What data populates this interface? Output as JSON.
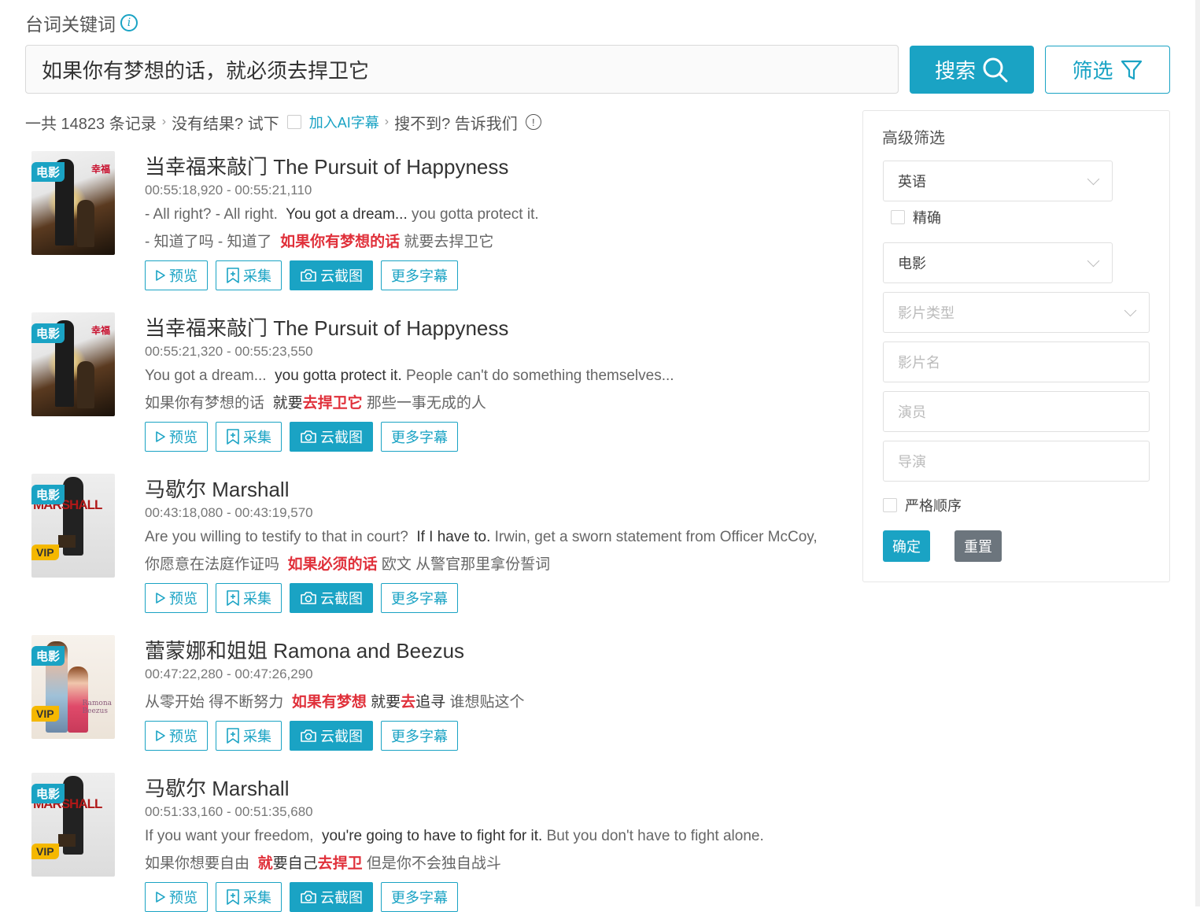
{
  "header": {
    "keyword_label": "台词关键词",
    "search_value": "如果你有梦想的话，就必须去捍卫它",
    "search_button": "搜索",
    "filter_button": "筛选"
  },
  "summary": {
    "total": "一共 14823 条记录",
    "no_result": "没有结果? 试下",
    "ai_link": "加入AI字幕",
    "not_found": "搜不到? 告诉我们"
  },
  "actions": {
    "preview": "预览",
    "collect": "采集",
    "screenshot": "云截图",
    "more": "更多字幕"
  },
  "badges": {
    "movie": "电影",
    "vip": "VIP"
  },
  "results": [
    {
      "title": "当幸福来敲门 The Pursuit of Happyness",
      "time": "00:55:18,920 - 00:55:21,110",
      "en": [
        {
          "t": "- All right? - All right.  ",
          "s": ""
        },
        {
          "t": "You got a dream...",
          "s": "dark"
        },
        {
          "t": " you gotta protect it.",
          "s": ""
        }
      ],
      "zh": [
        {
          "t": "- 知道了吗 - 知道了  ",
          "s": ""
        },
        {
          "t": "如果你有梦想的话",
          "s": "hl"
        },
        {
          "t": " 就要去捍卫它",
          "s": ""
        }
      ],
      "vip": false,
      "poster": "pursuit"
    },
    {
      "title": "当幸福来敲门 The Pursuit of Happyness",
      "time": "00:55:21,320 - 00:55:23,550",
      "en": [
        {
          "t": "You got a dream...  ",
          "s": ""
        },
        {
          "t": "you gotta protect it.",
          "s": "dark"
        },
        {
          "t": " People can't do something themselves...",
          "s": ""
        }
      ],
      "zh": [
        {
          "t": "如果你有梦想的话  ",
          "s": ""
        },
        {
          "t": "就要",
          "s": "dark"
        },
        {
          "t": "去捍卫它",
          "s": "hl"
        },
        {
          "t": " 那些一事无成的人",
          "s": ""
        }
      ],
      "vip": false,
      "poster": "pursuit"
    },
    {
      "title": "马歇尔 Marshall",
      "time": "00:43:18,080 - 00:43:19,570",
      "en": [
        {
          "t": "Are you willing to testify to that in court?  ",
          "s": ""
        },
        {
          "t": "If I have to.",
          "s": "dark"
        },
        {
          "t": " Irwin, get a sworn statement from Officer McCoy,",
          "s": ""
        }
      ],
      "zh": [
        {
          "t": "你愿意在法庭作证吗  ",
          "s": ""
        },
        {
          "t": "如果必须的话",
          "s": "hl"
        },
        {
          "t": " 欧文 从警官那里拿份誓词",
          "s": ""
        }
      ],
      "vip": true,
      "poster": "marshall"
    },
    {
      "title": "蕾蒙娜和姐姐 Ramona and Beezus",
      "time": "00:47:22,280 - 00:47:26,290",
      "zh": [
        {
          "t": "从零开始 得不断努力  ",
          "s": ""
        },
        {
          "t": "如果有梦想",
          "s": "hl"
        },
        {
          "t": " ",
          "s": ""
        },
        {
          "t": "就要",
          "s": "dark"
        },
        {
          "t": "去",
          "s": "hl"
        },
        {
          "t": "追寻",
          "s": "dark"
        },
        {
          "t": " 谁想贴这个",
          "s": ""
        }
      ],
      "vip": true,
      "poster": "ramona"
    },
    {
      "title": "马歇尔 Marshall",
      "time": "00:51:33,160 - 00:51:35,680",
      "en": [
        {
          "t": "If you want your freedom,  ",
          "s": ""
        },
        {
          "t": "you're going to have to fight for it.",
          "s": "dark"
        },
        {
          "t": " But you don't have to fight alone.",
          "s": ""
        }
      ],
      "zh": [
        {
          "t": "如果你想要自由  ",
          "s": ""
        },
        {
          "t": "就",
          "s": "hl"
        },
        {
          "t": "要自己",
          "s": "dark"
        },
        {
          "t": "去捍卫",
          "s": "hl"
        },
        {
          "t": " 但是你不会独自战斗",
          "s": ""
        }
      ],
      "vip": true,
      "poster": "marshall"
    }
  ],
  "panel": {
    "title": "高级筛选",
    "language": "英语",
    "exact": "精确",
    "category": "电影",
    "genre_placeholder": "影片类型",
    "name_placeholder": "影片名",
    "actor_placeholder": "演员",
    "director_placeholder": "导演",
    "strict_order": "严格顺序",
    "confirm": "确定",
    "reset": "重置"
  },
  "colors": {
    "accent": "#1aa3c4",
    "highlight": "#e0303a",
    "vip": "#f5b800",
    "reset": "#6c757d"
  }
}
